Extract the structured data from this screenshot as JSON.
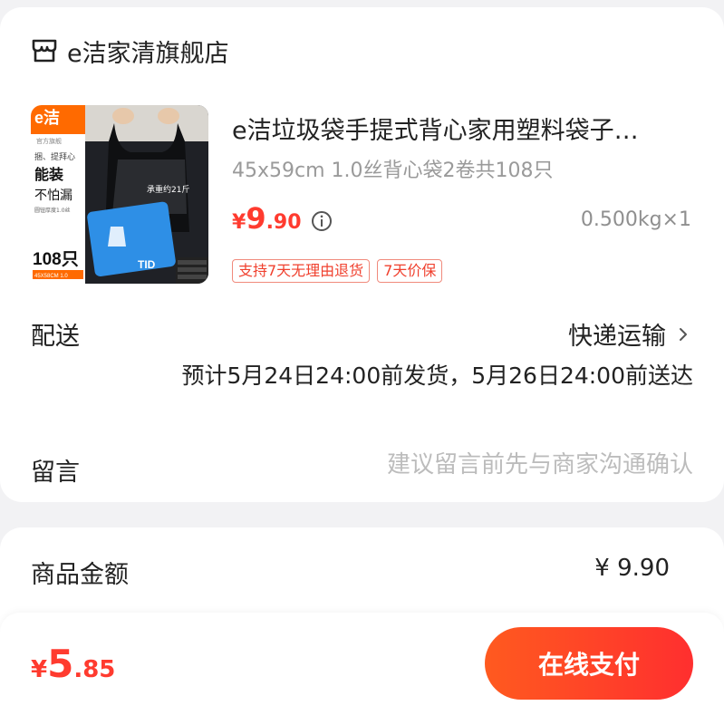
{
  "store": {
    "name": "e洁家清旗舰店",
    "icon": "store-icon"
  },
  "product": {
    "title": "e洁垃圾袋手提式背心家用塑料袋子…",
    "spec": "45x59cm 1.0丝背心袋2卷共108只",
    "price_currency": "¥",
    "price_int": "9",
    "price_dec": ".90",
    "weight": "0.500kg×1",
    "tags": [
      "支持7天无理由退货",
      "7天价保"
    ],
    "image": {
      "brand": "e洁",
      "sub": "官方旗舰",
      "line1": "捆、提拜心",
      "big1": "能装",
      "big2": "不怕漏",
      "small1": "圆钮厚度1.0丝",
      "count": "108只",
      "size": "45X58CM 1.0",
      "weight_note": "承重约21斤",
      "pack_text": "TID"
    }
  },
  "shipping": {
    "label": "配送",
    "method": "快递运输",
    "estimate": "预计5月24日24:00前发货，5月26日24:00前送达"
  },
  "message": {
    "label": "留言",
    "placeholder": "建议留言前先与商家沟通确认"
  },
  "amount": {
    "label": "商品金额",
    "value": "¥ 9.90"
  },
  "footer": {
    "total_currency": "¥",
    "total_int": "5",
    "total_dec": ".85",
    "pay_label": "在线支付"
  },
  "colors": {
    "accent": "#ff3b2f",
    "button_start": "#ff5a1f",
    "button_end": "#ff2f2f"
  }
}
